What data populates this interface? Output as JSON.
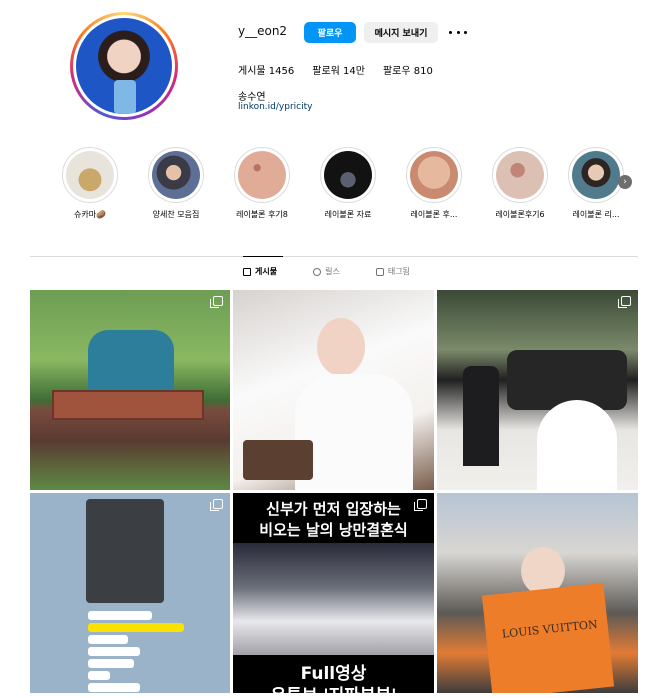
{
  "profile": {
    "username": "y__eon2",
    "follow_label": "팔로우",
    "message_label": "메시지 보내기",
    "posts_label": "게시물",
    "posts_count": "1456",
    "followers_label": "팔로워",
    "followers_count": "14만",
    "following_label": "팔로우",
    "following_count": "810",
    "full_name": "송수연",
    "link": "linkon.id/ypricity"
  },
  "highlights": [
    {
      "label": "슈카마🥔",
      "color": "#d7c7a3"
    },
    {
      "label": "양세찬 모음집",
      "color": "#4a5a78"
    },
    {
      "label": "레이볼론 후기8",
      "color": "#d9a593"
    },
    {
      "label": "레이볼론 자료",
      "color": "#1b1b1b"
    },
    {
      "label": "레이볼론 후...",
      "color": "#e6b89e"
    },
    {
      "label": "레이볼론후기6",
      "color": "#d7b5a7"
    },
    {
      "label": "레이볼론 리...",
      "color": "#3a4e5a"
    }
  ],
  "tabs": [
    {
      "label": "게시물"
    },
    {
      "label": "릴스"
    },
    {
      "label": "태그됨"
    }
  ],
  "posts": [
    {
      "name": "swing-photo"
    },
    {
      "name": "bride-lipstick-photo"
    },
    {
      "name": "wedding-hall-photo"
    },
    {
      "name": "chat-screenshot"
    },
    {
      "name": "wedding-video-thumb",
      "top_text_1": "신부가 먼저 입장하는",
      "top_text_2": "비오는 날의 낭만결혼식",
      "bottom_text_1": "Full영상",
      "bottom_text_2": "유튜브 '지파부부'"
    },
    {
      "name": "lv-bag-photo",
      "brand": "LOUIS VUITTON"
    }
  ],
  "colors": {
    "accent": "#0095f6",
    "link": "#00376b",
    "divider": "#dbdbdb"
  }
}
